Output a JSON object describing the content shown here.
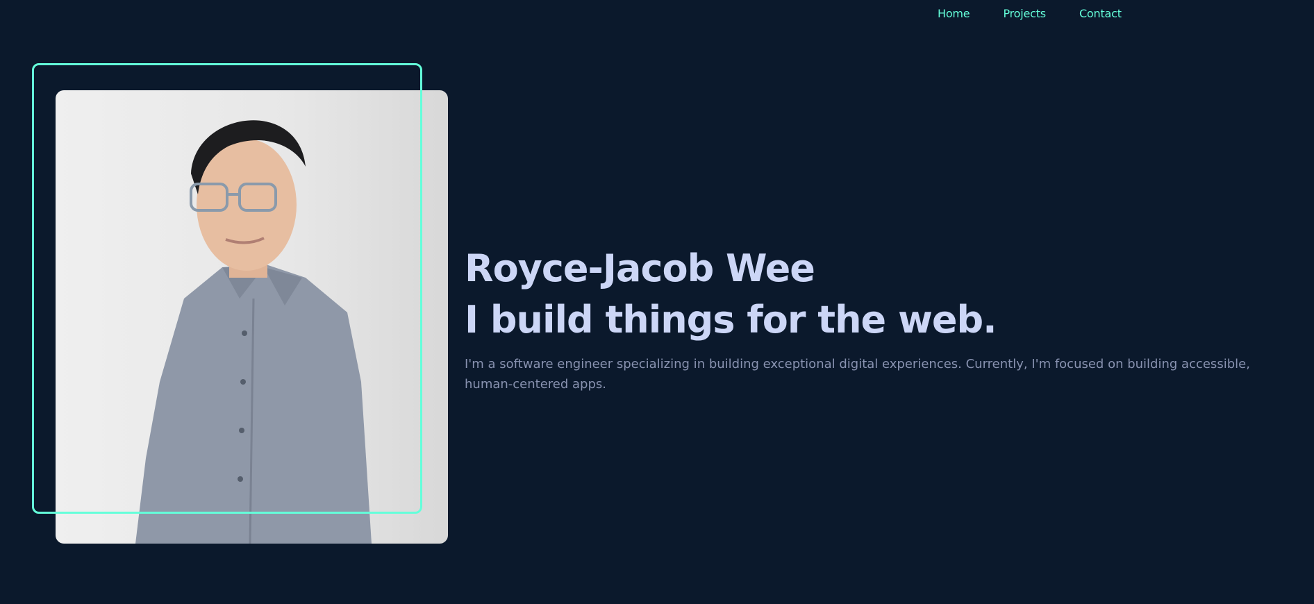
{
  "nav": {
    "items": [
      "Home",
      "Projects",
      "Contact"
    ]
  },
  "hero": {
    "name": "Royce-Jacob Wee",
    "tagline": "I build things for the web.",
    "description": "I'm a software engineer specializing in building exceptional digital experiences. Currently, I'm focused on building accessible, human-centered apps."
  },
  "colors": {
    "background": "#0b192c",
    "accent": "#64ffda",
    "heading": "#ccd6f6",
    "body_text": "#8892b0"
  }
}
